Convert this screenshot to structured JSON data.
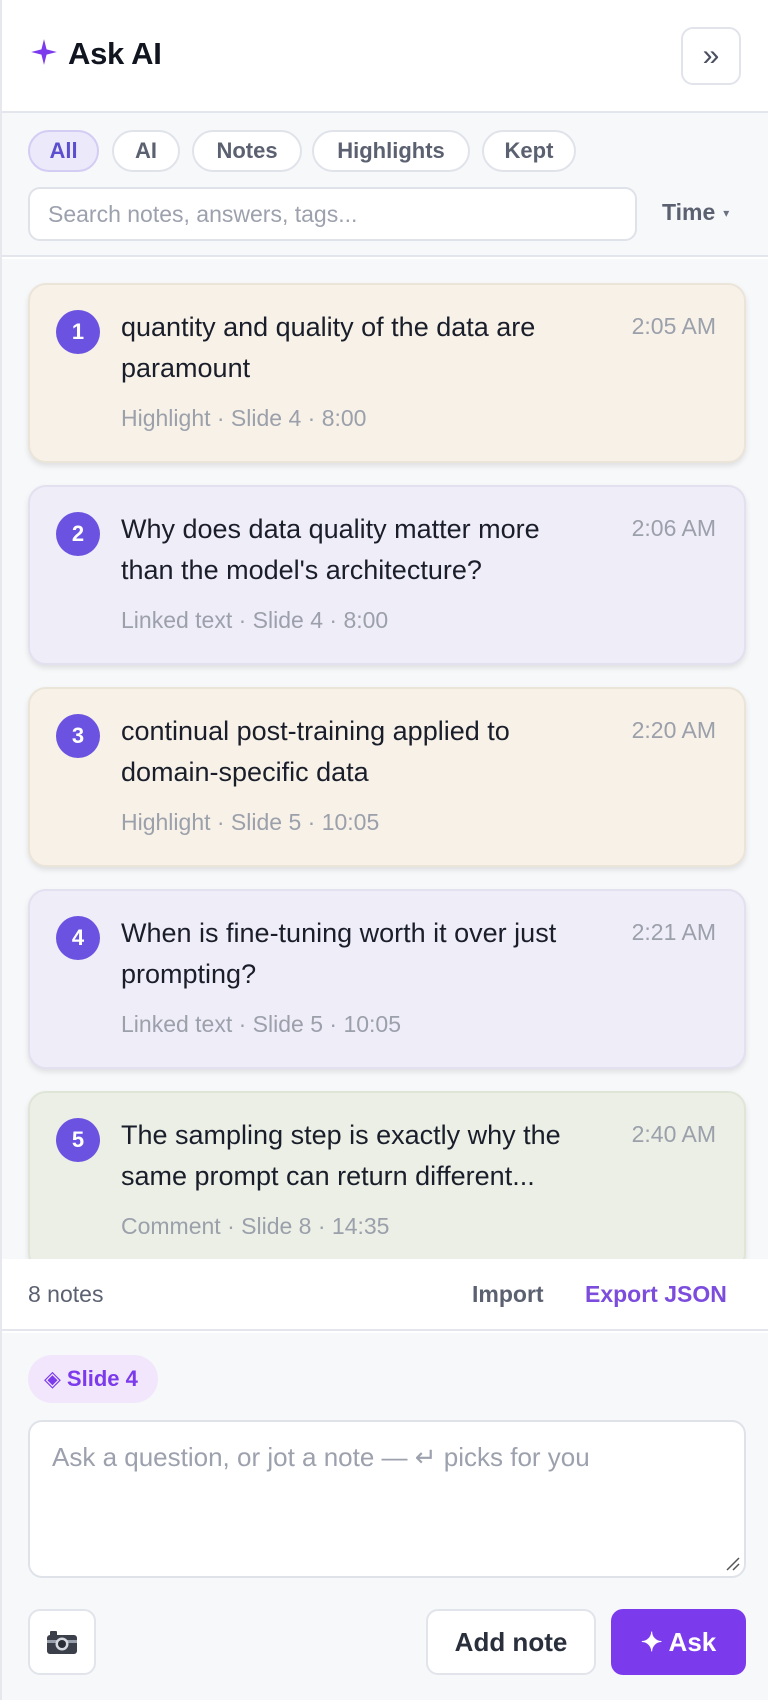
{
  "header": {
    "title": "Ask AI",
    "collapse_label": "»"
  },
  "filters": {
    "chips": [
      {
        "label": "All",
        "active": true
      },
      {
        "label": "AI",
        "active": false
      },
      {
        "label": "Notes",
        "active": false
      },
      {
        "label": "Highlights",
        "active": false
      },
      {
        "label": "Kept",
        "active": false
      }
    ],
    "search_placeholder": "Search notes, answers, tags...",
    "sort_label": "Time",
    "sort_caret": "▾"
  },
  "notes": [
    {
      "num": "1",
      "text": "quantity and quality of the data are paramount",
      "time": "2:05 AM",
      "meta": "Highlight · Slide 4 · 8:00",
      "kind": "highlight"
    },
    {
      "num": "2",
      "text": "Why does data quality matter more than the model's architecture?",
      "time": "2:06 AM",
      "meta": "Linked text · Slide 4 · 8:00",
      "kind": "ai"
    },
    {
      "num": "3",
      "text": "continual post-training applied to domain-specific data",
      "time": "2:20 AM",
      "meta": "Highlight · Slide 5 · 10:05",
      "kind": "highlight"
    },
    {
      "num": "4",
      "text": "When is fine-tuning worth it over just prompting?",
      "time": "2:21 AM",
      "meta": "Linked text · Slide 5 · 10:05",
      "kind": "ai"
    },
    {
      "num": "5",
      "text": "The sampling step is exactly why the same prompt can return different...",
      "time": "2:40 AM",
      "meta": "Comment · Slide 8 · 14:35",
      "kind": "comment"
    }
  ],
  "status": {
    "count": "8 notes",
    "import_label": "Import",
    "export_label": "Export JSON"
  },
  "composer": {
    "slide_chip": "Slide 4",
    "slide_chip_icon": "◈",
    "placeholder": "Ask a question, or jot a note — ↵ picks for you",
    "add_note_label": "Add note",
    "ask_label": "Ask",
    "ask_icon": "✦"
  },
  "colors": {
    "accent": "#7c3aed",
    "badge": "#6b52e0",
    "highlight_card": "#f7f1e8",
    "ai_card": "#efedf8",
    "comment_card": "#ebefe6"
  }
}
